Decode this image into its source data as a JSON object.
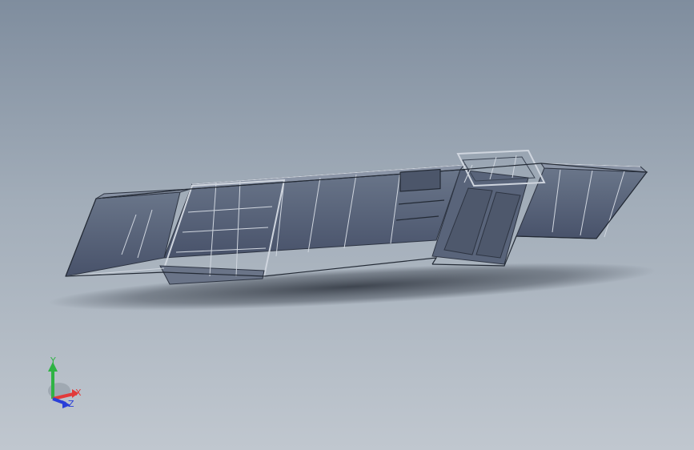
{
  "viewport": {
    "background_top": "#7f8d9e",
    "background_bottom": "#c0c7cf"
  },
  "model": {
    "frame_color": "#3a4352",
    "panel_color": "#5b6678",
    "panel_dark": "#4a5466",
    "shadow_color": "#2e3440"
  },
  "triad": {
    "x_label": "X",
    "y_label": "Y",
    "z_label": "Z",
    "x_color": "#e23a3a",
    "y_color": "#2fb344",
    "z_color": "#2a3fd8"
  }
}
